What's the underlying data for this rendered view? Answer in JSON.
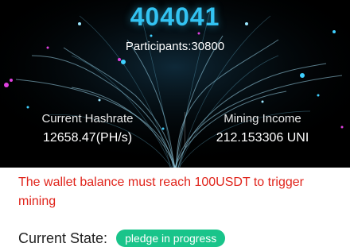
{
  "hero": {
    "block_number": "404041",
    "participants": "Participants:30800"
  },
  "stats": {
    "hashrate": {
      "label": "Current Hashrate",
      "value": "12658.47(PH/s)"
    },
    "income": {
      "label": "Mining Income",
      "value": "212.153306 UNI"
    }
  },
  "notice": "The wallet balance must reach 100USDT to trigger mining",
  "state": {
    "label": "Current State:",
    "badge": "pledge in progress"
  },
  "colors": {
    "accent_blue": "#33c3f2",
    "warning_red": "#e0241b",
    "badge_green": "#19c48a"
  }
}
